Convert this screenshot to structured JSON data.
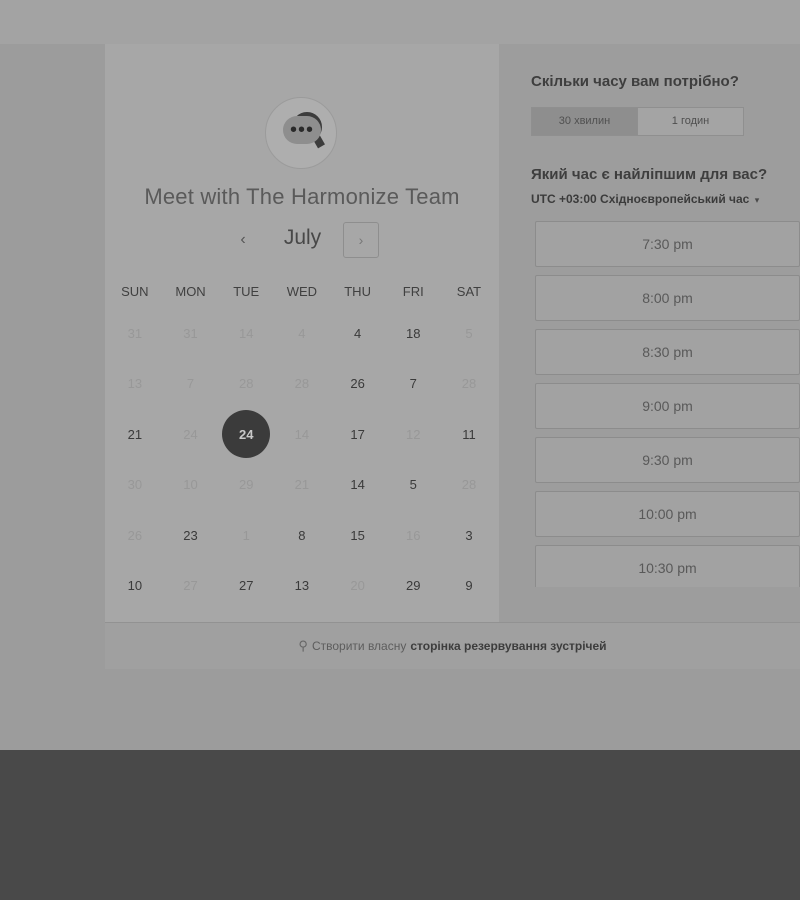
{
  "booking": {
    "title": "Meet with The Harmonize Team",
    "month": "July",
    "prev_icon": "‹",
    "next_icon": "›",
    "weekdays": [
      "SUN",
      "MON",
      "TUE",
      "WED",
      "THU",
      "FRI",
      "SAT"
    ],
    "weeks": [
      [
        {
          "d": "31",
          "m": true
        },
        {
          "d": "31",
          "m": true
        },
        {
          "d": "14",
          "m": true
        },
        {
          "d": "4",
          "m": true
        },
        {
          "d": "4",
          "m": false
        },
        {
          "d": "18",
          "m": false
        },
        {
          "d": "5",
          "m": true
        }
      ],
      [
        {
          "d": "13",
          "m": true
        },
        {
          "d": "7",
          "m": true
        },
        {
          "d": "28",
          "m": true
        },
        {
          "d": "28",
          "m": true
        },
        {
          "d": "26",
          "m": false
        },
        {
          "d": "7",
          "m": false
        },
        {
          "d": "28",
          "m": true
        }
      ],
      [
        {
          "d": "21",
          "m": false
        },
        {
          "d": "24",
          "m": true
        },
        {
          "d": "24",
          "m": false,
          "s": true
        },
        {
          "d": "14",
          "m": true
        },
        {
          "d": "17",
          "m": false
        },
        {
          "d": "12",
          "m": true
        },
        {
          "d": "11",
          "m": false
        }
      ],
      [
        {
          "d": "30",
          "m": true
        },
        {
          "d": "10",
          "m": true
        },
        {
          "d": "29",
          "m": true
        },
        {
          "d": "21",
          "m": true
        },
        {
          "d": "14",
          "m": false
        },
        {
          "d": "5",
          "m": false
        },
        {
          "d": "28",
          "m": true
        }
      ],
      [
        {
          "d": "26",
          "m": true
        },
        {
          "d": "23",
          "m": false
        },
        {
          "d": "1",
          "m": true
        },
        {
          "d": "8",
          "m": false
        },
        {
          "d": "15",
          "m": false
        },
        {
          "d": "16",
          "m": true
        },
        {
          "d": "3",
          "m": false
        }
      ],
      [
        {
          "d": "10",
          "m": false
        },
        {
          "d": "27",
          "m": true
        },
        {
          "d": "27",
          "m": false
        },
        {
          "d": "13",
          "m": false
        },
        {
          "d": "20",
          "m": true
        },
        {
          "d": "29",
          "m": false
        },
        {
          "d": "9",
          "m": false
        }
      ]
    ],
    "selected_day": "24"
  },
  "duration": {
    "question": "Скільки часу вам потрібно?",
    "options": [
      "30 хвилин",
      "1 годин"
    ],
    "selected": "30 хвилин"
  },
  "times": {
    "question": "Який час є найліпшим для вас?",
    "tz_offset": "UTC +03:00",
    "tz_name": "Східноєвропейський час",
    "tz_caret": "▾",
    "slots": [
      "7:30 pm",
      "8:00 pm",
      "8:30 pm",
      "9:00 pm",
      "9:30 pm",
      "10:00 pm",
      "10:30 pm"
    ]
  },
  "footer": {
    "icon": "sprocket-icon",
    "prefix": "Створити власну",
    "bold": "сторінка резервування зустрічей"
  }
}
